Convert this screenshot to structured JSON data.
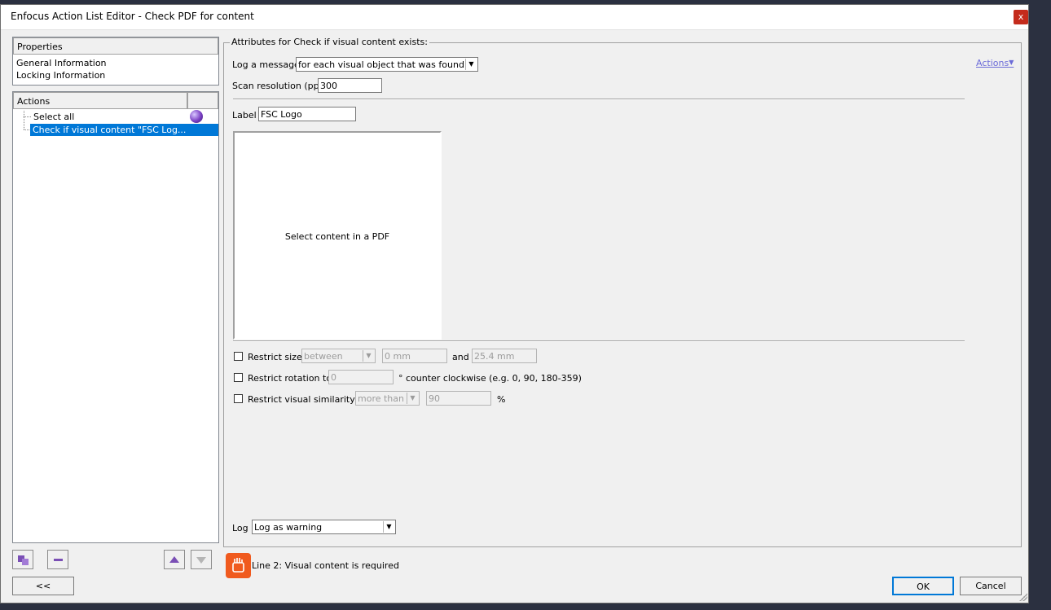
{
  "window": {
    "title": "Enfocus Action List Editor - Check PDF for content",
    "close_label": "x"
  },
  "left": {
    "properties_header": "Properties",
    "properties_items": [
      "General Information",
      "Locking Information"
    ],
    "actions_header": "Actions",
    "actions_items": [
      {
        "label": "Select all"
      },
      {
        "label": "Check if visual content \"FSC Log..."
      }
    ]
  },
  "main": {
    "group_title": "Attributes for Check if visual content exists:",
    "log_message_label": "Log a message",
    "log_message_value": "for each visual object that was found",
    "scan_res_label": "Scan resolution (ppi)",
    "scan_res_value": "300",
    "actions_link": "Actions",
    "label_label": "Label",
    "label_value": "FSC Logo",
    "preview_text": "Select content in a PDF",
    "restrict_size_label": "Restrict size",
    "restrict_size_mode": "between",
    "restrict_size_min": "0 mm",
    "and_label": "and",
    "restrict_size_max": "25.4 mm",
    "restrict_rotation_label": "Restrict rotation to",
    "restrict_rotation_value": "0",
    "rotation_suffix": "° counter clockwise (e.g. 0, 90, 180-359)",
    "restrict_similarity_label": "Restrict visual similarity to",
    "similarity_mode": "more than",
    "similarity_value": "90",
    "percent_label": "%",
    "log_label": "Log",
    "log_value": "Log as warning"
  },
  "footer": {
    "status_text": "Line 2: Visual content is required",
    "collapse_button": "<<",
    "ok_button": "OK",
    "cancel_button": "Cancel"
  },
  "colors": {
    "selection": "#0078d7",
    "status_icon": "#f05a1e",
    "link": "#6b6bd8"
  }
}
